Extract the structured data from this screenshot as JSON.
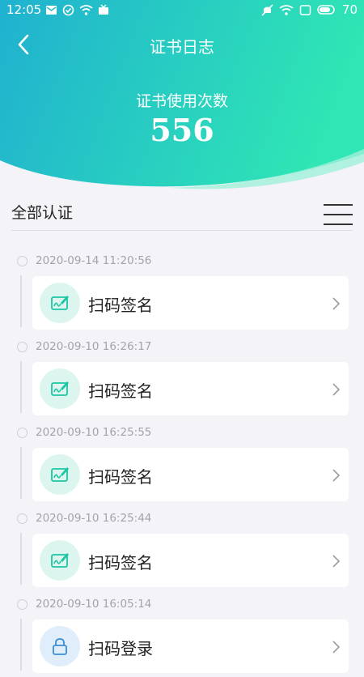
{
  "status_bar": {
    "time": "12:05",
    "battery": "70",
    "left_icons": [
      "mail-icon",
      "check-circle-icon",
      "wifi-icon",
      "tv-icon"
    ],
    "right_icons": [
      "mute-icon",
      "wifi-icon",
      "screen-icon",
      "battery-icon"
    ]
  },
  "nav": {
    "title": "证书日志"
  },
  "summary": {
    "label": "证书使用次数",
    "count": "556"
  },
  "filter": {
    "label": "全部认证"
  },
  "colors": {
    "gradient_start": "#22b5cf",
    "gradient_end": "#2fe4b6",
    "card_icon_bg": "#ddf5ef",
    "card_icon": "#1cc6a2"
  },
  "entries": [
    {
      "timestamp": "2020-09-14 11:20:56",
      "label": "扫码签名",
      "icon": "signature-icon"
    },
    {
      "timestamp": "2020-09-10 16:26:17",
      "label": "扫码签名",
      "icon": "signature-icon"
    },
    {
      "timestamp": "2020-09-10 16:25:55",
      "label": "扫码签名",
      "icon": "signature-icon"
    },
    {
      "timestamp": "2020-09-10 16:25:44",
      "label": "扫码签名",
      "icon": "signature-icon"
    },
    {
      "timestamp": "2020-09-10 16:05:14",
      "label": "扫码登录",
      "icon": "lock-icon"
    }
  ]
}
